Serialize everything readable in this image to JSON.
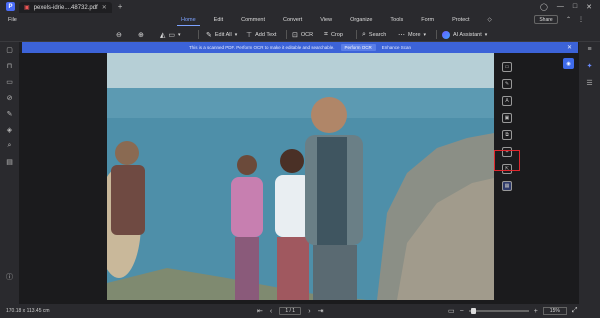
{
  "titlebar": {
    "tab_name": "pexels-idrie....48732.pdf",
    "new_tab": "+"
  },
  "menubar": {
    "file": "File",
    "items": [
      "Home",
      "Edit",
      "Comment",
      "Convert",
      "View",
      "Organize",
      "Tools",
      "Form",
      "Protect"
    ],
    "active": "Home",
    "share": "Share"
  },
  "toolbar": {
    "edit_all": "Edit All",
    "add_text": "Add Text",
    "ocr": "OCR",
    "crop": "Crop",
    "search": "Search",
    "more": "More",
    "ai_assistant": "AI Assistant"
  },
  "notice": {
    "text": "This is a scanned PDF. Perform OCR to make it editable and searchable.",
    "perform_ocr": "Perform OCR",
    "enhance_scan": "Enhance Scan"
  },
  "status": {
    "dimensions": "170.18 x 113.45 cm",
    "page": "1 / 1",
    "zoom": "15%"
  },
  "colors": {
    "accent": "#3c63d8",
    "highlight": "#e0282e",
    "bg": "#1f1f22"
  }
}
